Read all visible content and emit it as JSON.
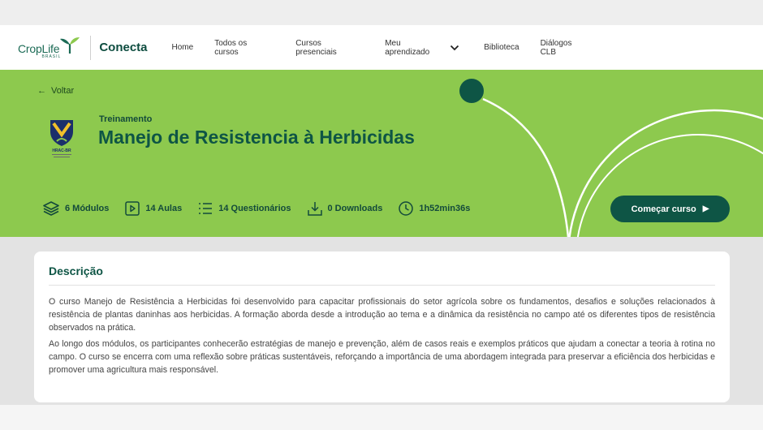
{
  "brand": {
    "logo_text": "CropLife",
    "logo_sub": "BRASIL",
    "app_name": "Conecta"
  },
  "nav": {
    "home": "Home",
    "all_courses": "Todos os cursos",
    "in_person": "Cursos presenciais",
    "my_learning": "Meu aprendizado",
    "library": "Biblioteca",
    "dialogues": "Diálogos CLB"
  },
  "hero": {
    "back_label": "Voltar",
    "eyebrow": "Treinamento",
    "title": "Manejo de Resistencia à Herbicidas",
    "badge_label": "HRAC-BR",
    "stats": {
      "modules": "6 Módulos",
      "lessons": "14 Aulas",
      "quizzes": "14 Questionários",
      "downloads": "0 Downloads",
      "duration": "1h52min36s"
    },
    "start_button": "Começar curso",
    "colors": {
      "banner": "#8dc94e",
      "accent": "#0e5545"
    }
  },
  "description": {
    "title": "Descrição",
    "paragraphs": [
      "O curso Manejo de Resistência a Herbicidas foi desenvolvido para capacitar profissionais do setor agrícola sobre os fundamentos, desafios e soluções relacionados à resistência de plantas daninhas aos herbicidas. A formação aborda desde a introdução ao tema e a dinâmica da resistência no campo até os diferentes tipos de resistência observados na prática.",
      "Ao longo dos módulos, os participantes conhecerão estratégias de manejo e prevenção, além de casos reais e exemplos práticos que ajudam a conectar a teoria à rotina no campo. O curso se encerra com uma reflexão sobre práticas sustentáveis, reforçando a importância de uma abordagem integrada para preservar a eficiência dos herbicidas e promover uma agricultura mais responsável."
    ]
  }
}
